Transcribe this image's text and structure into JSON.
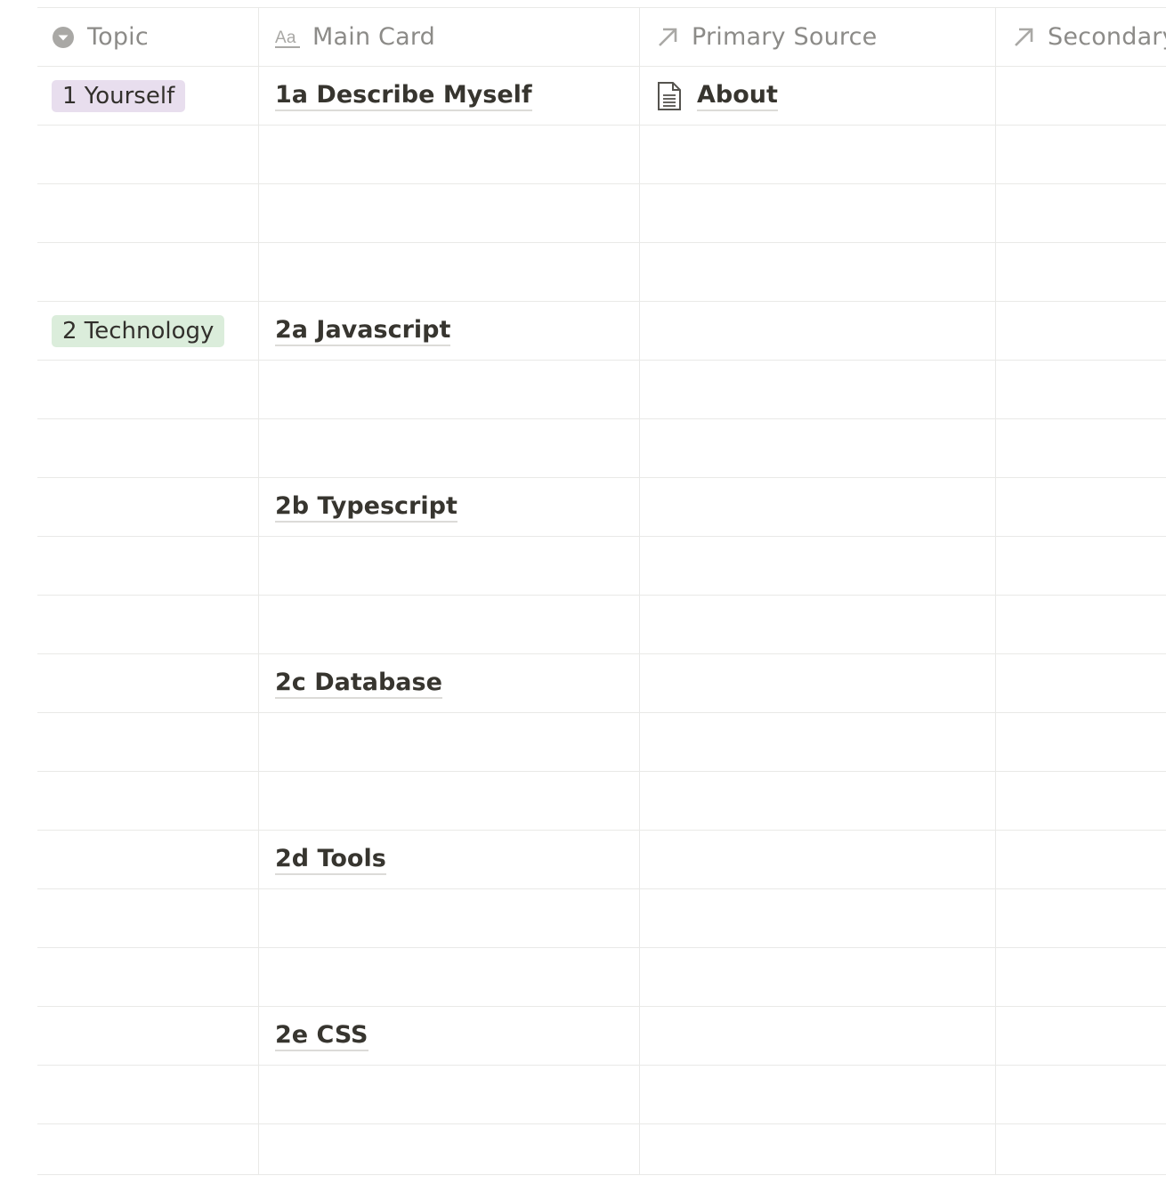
{
  "columns": {
    "topic": {
      "label": "Topic",
      "icon": "select-icon"
    },
    "main_card": {
      "label": "Main Card",
      "icon": "title-aa-icon"
    },
    "primary_source": {
      "label": "Primary Source",
      "icon": "relation-arrow-icon"
    },
    "secondary": {
      "label": "Secondary",
      "icon": "relation-arrow-icon"
    }
  },
  "colors": {
    "tag_yourself_bg": "#e8deee",
    "tag_technology_bg": "#dbeddb",
    "grid_line": "#e9e9e7",
    "header_text": "#8c8b88"
  },
  "rows": [
    {
      "topic": "1 Yourself",
      "topic_color": "#e8deee",
      "main_card": "1a Describe Myself",
      "primary_source": "About",
      "primary_icon": "page-icon"
    },
    {
      "topic": "",
      "main_card": "",
      "primary_source": ""
    },
    {
      "topic": "",
      "main_card": "",
      "primary_source": ""
    },
    {
      "topic": "",
      "main_card": "",
      "primary_source": ""
    },
    {
      "topic": "2 Technology",
      "topic_color": "#dbeddb",
      "main_card": "2a Javascript",
      "primary_source": ""
    },
    {
      "topic": "",
      "main_card": "",
      "primary_source": ""
    },
    {
      "topic": "",
      "main_card": "",
      "primary_source": ""
    },
    {
      "topic": "",
      "main_card": "2b Typescript",
      "primary_source": ""
    },
    {
      "topic": "",
      "main_card": "",
      "primary_source": ""
    },
    {
      "topic": "",
      "main_card": "",
      "primary_source": ""
    },
    {
      "topic": "",
      "main_card": "2c Database",
      "primary_source": ""
    },
    {
      "topic": "",
      "main_card": "",
      "primary_source": ""
    },
    {
      "topic": "",
      "main_card": "",
      "primary_source": ""
    },
    {
      "topic": "",
      "main_card": "2d Tools",
      "primary_source": ""
    },
    {
      "topic": "",
      "main_card": "",
      "primary_source": ""
    },
    {
      "topic": "",
      "main_card": "",
      "primary_source": ""
    },
    {
      "topic": "",
      "main_card": "2e CSS",
      "primary_source": ""
    },
    {
      "topic": "",
      "main_card": "",
      "primary_source": ""
    },
    {
      "topic": "",
      "main_card": "",
      "primary_source": ""
    }
  ]
}
